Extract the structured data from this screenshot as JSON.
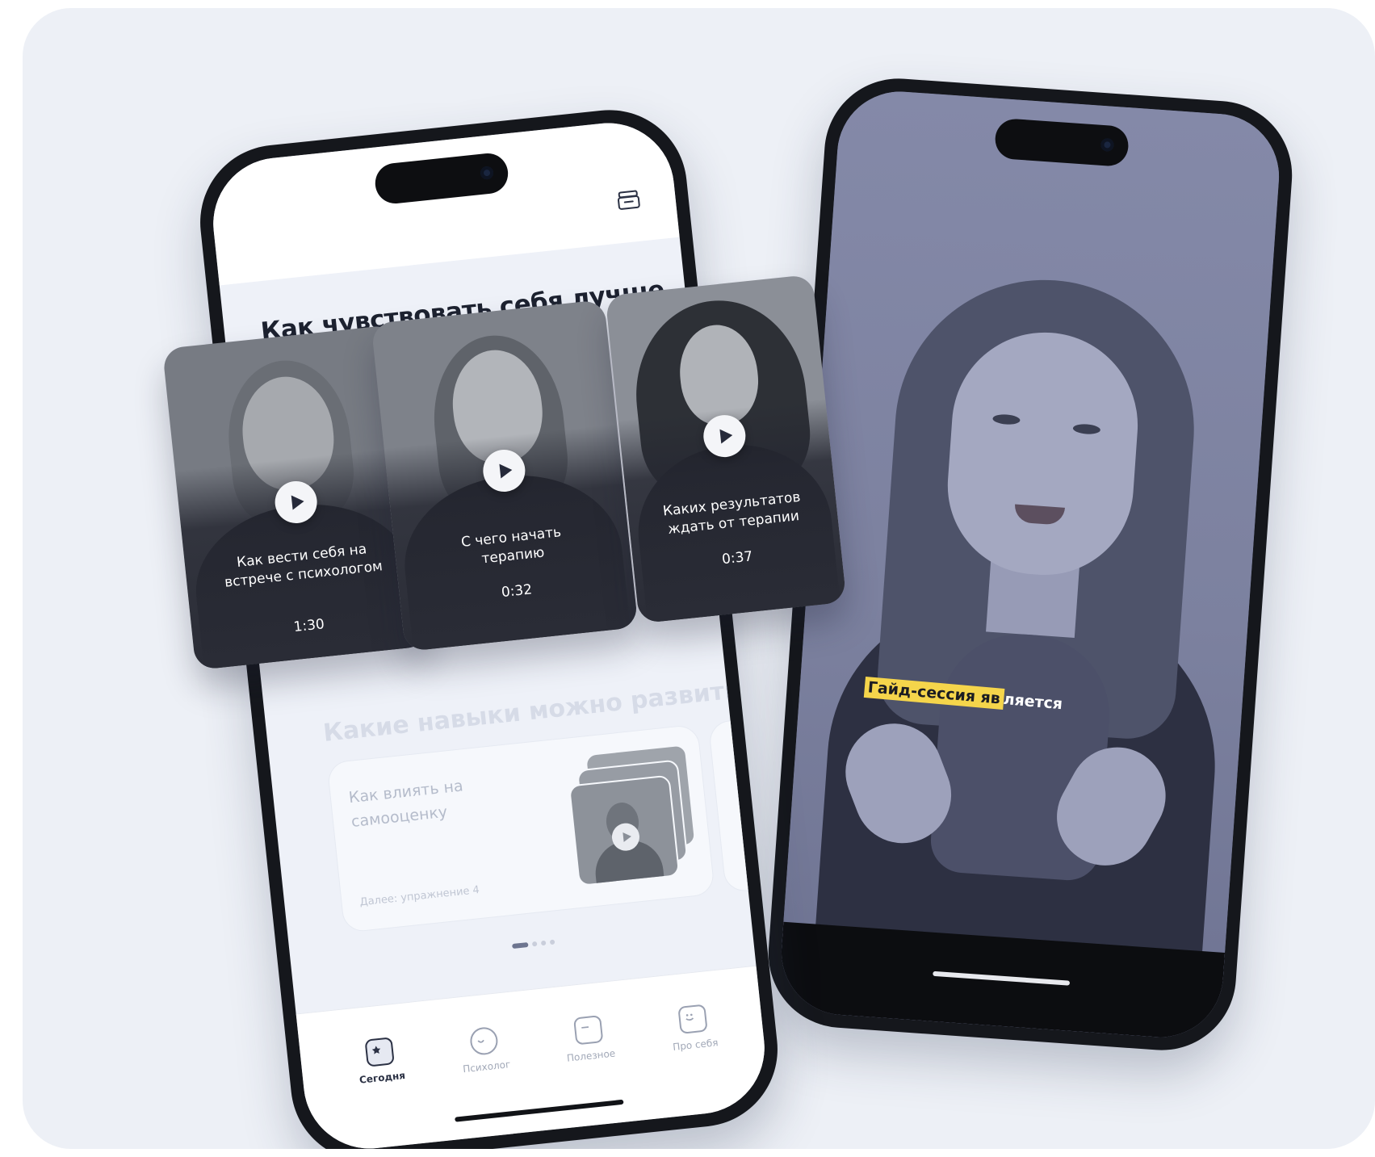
{
  "left_phone": {
    "section_title": "Как чувствовать себя лучше",
    "section2_title": "Какие навыки можно развить",
    "skill_card": {
      "title": "Как влиять на самооценку",
      "next": "Далее: упражнение 4"
    },
    "tabs": [
      {
        "label": "Сегодня",
        "icon": "star-calendar-icon",
        "active": true
      },
      {
        "label": "Психолог",
        "icon": "face-icon",
        "active": false
      },
      {
        "label": "Полезное",
        "icon": "box-icon",
        "active": false
      },
      {
        "label": "Про себя",
        "icon": "smile-icon",
        "active": false
      }
    ],
    "pager": {
      "count": 4,
      "active_index": 0
    }
  },
  "video_cards": [
    {
      "title": "Как вести себя на встрече с психологом",
      "duration": "1:30"
    },
    {
      "title": "С чего начать терапию",
      "duration": "0:32"
    },
    {
      "title": "Каких результатов ждать от терапии",
      "duration": "0:37"
    }
  ],
  "right_phone": {
    "subtitle_highlight": "Гайд-сессия яв",
    "subtitle_rest": "ляется"
  },
  "colors": {
    "background": "#edf0f6",
    "highlight": "#f5d54b",
    "dark": "#1d2230"
  }
}
